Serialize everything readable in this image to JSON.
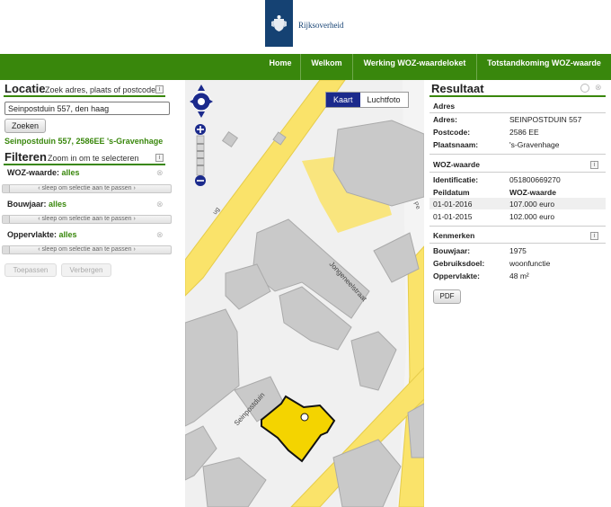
{
  "header": {
    "brand": "Rijksoverheid",
    "nav": [
      "Home",
      "Welkom",
      "Werking WOZ-waardeloket",
      "Totstandkoming WOZ-waarde"
    ]
  },
  "locatie": {
    "title": "Locatie",
    "subtitle": "Zoek adres, plaats of postcode",
    "search_value": "Seinpostduin 557, den haag",
    "search_button": "Zoeken",
    "result_text": "Seinpostduin 557, 2586EE 's-Gravenhage"
  },
  "filteren": {
    "title": "Filteren",
    "subtitle": "Zoom in om te selecteren",
    "filters": [
      {
        "label": "WOZ-waarde:",
        "value": "alles",
        "slider_text": "‹ sleep om selectie aan te passen ›"
      },
      {
        "label": "Bouwjaar:",
        "value": "alles",
        "slider_text": "‹ sleep om selectie aan te passen ›"
      },
      {
        "label": "Oppervlakte:",
        "value": "alles",
        "slider_text": "‹ sleep om selectie aan te passen ›"
      }
    ],
    "apply_button": "Toepassen",
    "hide_button": "Verbergen"
  },
  "map": {
    "toggle": [
      "Kaart",
      "Luchtfoto"
    ],
    "active_toggle": "Kaart",
    "street_labels": [
      "Jongeneelstraat",
      "Seinpostduin",
      "ug",
      "Pe"
    ],
    "colors": {
      "highlight": "#f4d400",
      "road": "#fae36a",
      "building": "#c9c9c9"
    }
  },
  "resultaat": {
    "title": "Resultaat",
    "adres": {
      "title": "Adres",
      "rows": [
        {
          "k": "Adres:",
          "v": "SEINPOSTDUIN 557"
        },
        {
          "k": "Postcode:",
          "v": "2586 EE"
        },
        {
          "k": "Plaatsnaam:",
          "v": "'s-Gravenhage"
        }
      ]
    },
    "woz": {
      "title": "WOZ-waarde",
      "rows": [
        {
          "k": "Identificatie:",
          "v": "051800669270"
        },
        {
          "k": "Peildatum",
          "v": "WOZ-waarde"
        },
        {
          "k": "01-01-2016",
          "v": "107.000 euro"
        },
        {
          "k": "01-01-2015",
          "v": "102.000 euro"
        }
      ]
    },
    "kenmerken": {
      "title": "Kenmerken",
      "rows": [
        {
          "k": "Bouwjaar:",
          "v": "1975"
        },
        {
          "k": "Gebruiksdoel:",
          "v": "woonfunctie"
        },
        {
          "k": "Oppervlakte:",
          "v": "48 m²"
        }
      ]
    },
    "pdf_button": "PDF"
  },
  "icons": {
    "info": "i",
    "close": "⊗"
  },
  "colors": {
    "green": "#39870c",
    "blue": "#154273",
    "toggle_active": "#1b2a8c"
  }
}
